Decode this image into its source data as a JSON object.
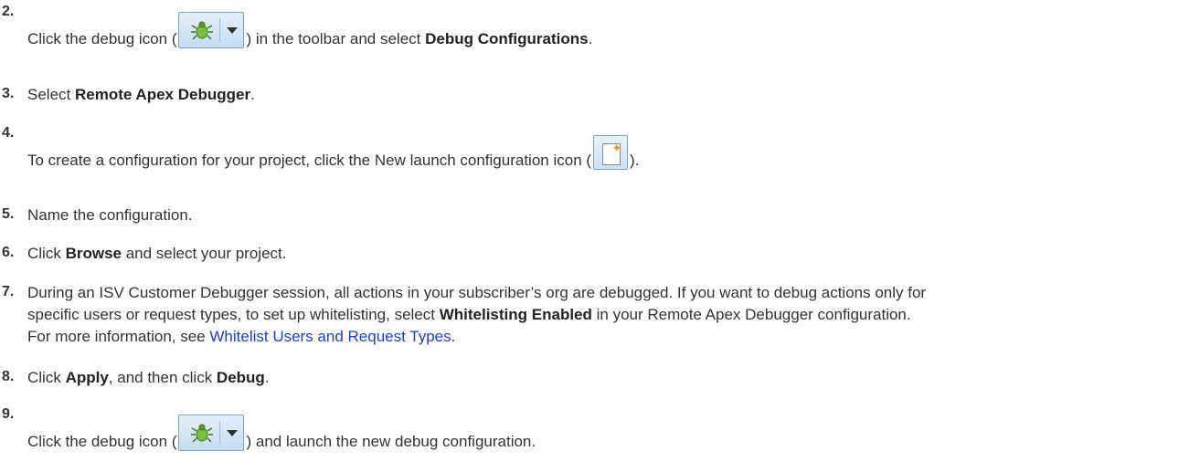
{
  "steps": [
    {
      "num": "2.",
      "pre": "Click the debug icon (",
      "icon": "debug-bug-icon",
      "mid": ") in the toolbar and select ",
      "bold": "Debug Configurations",
      "post": "."
    },
    {
      "num": "3.",
      "pre": "Select ",
      "bold": "Remote Apex Debugger",
      "post": "."
    },
    {
      "num": "4.",
      "pre": "To create a configuration for your project, click the New launch configuration icon (",
      "icon": "new-launch-configuration-icon",
      "post": ")."
    },
    {
      "num": "5.",
      "text": "Name the configuration."
    },
    {
      "num": "6.",
      "pre": "Click ",
      "bold": "Browse",
      "post": " and select your project."
    },
    {
      "num": "7.",
      "line1": "During an ISV Customer Debugger session, all actions in your subscriber’s org are debugged. If you want to debug actions only for",
      "line2_pre": "specific users or request types, to set up whitelisting, select ",
      "line2_bold": "Whitelisting Enabled",
      "line2_post": " in your Remote Apex Debugger configuration.",
      "line3_pre": "For more information, see ",
      "line3_link": "Whitelist Users and Request Types",
      "line3_post": "."
    },
    {
      "num": "8.",
      "pre": "Click ",
      "bold": "Apply",
      "mid": ", and then click ",
      "bold2": "Debug",
      "post": "."
    },
    {
      "num": "9.",
      "pre": "Click the debug icon (",
      "icon": "debug-bug-icon",
      "post": ") and launch the new debug configuration."
    }
  ],
  "colors": {
    "text": "#333333",
    "link": "#1a3fd8",
    "icon_border": "#7aa6cf"
  }
}
